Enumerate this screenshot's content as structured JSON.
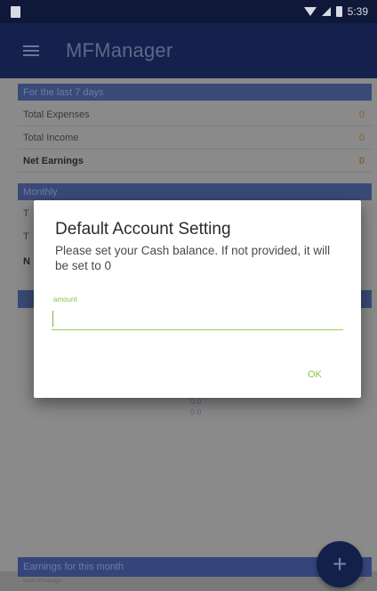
{
  "status_bar": {
    "time": "5:39",
    "icons": [
      "sim-icon",
      "wifi-icon",
      "signal-icon",
      "battery-icon"
    ]
  },
  "app_bar": {
    "title": "MFManager",
    "menu_icon": "hamburger-menu-icon"
  },
  "weekly": {
    "header": "For the last 7 days",
    "rows": [
      {
        "label": "Total Expenses",
        "value": "0"
      },
      {
        "label": "Total Income",
        "value": "0"
      },
      {
        "label": "Net Earnings",
        "value": "0"
      }
    ]
  },
  "monthly": {
    "header": "Monthly",
    "row_prefixes": [
      "T",
      "T",
      "N"
    ]
  },
  "chart": {
    "label_top": "0.0",
    "label_bottom": "0.0"
  },
  "footer": {
    "header": "Earnings for this month",
    "row_label": "www.mfmanager",
    "row_value": "0"
  },
  "fab": {
    "label": "+",
    "icon": "plus-icon"
  },
  "dialog": {
    "title": "Default Account Setting",
    "message": "Please set your Cash balance. If not provided, it will be set to 0",
    "field_label": "amount",
    "field_value": "",
    "ok_label": "OK"
  },
  "colors": {
    "primary": "#15214c",
    "accent": "#8bc34a",
    "scrim": "#8a8a8a"
  }
}
